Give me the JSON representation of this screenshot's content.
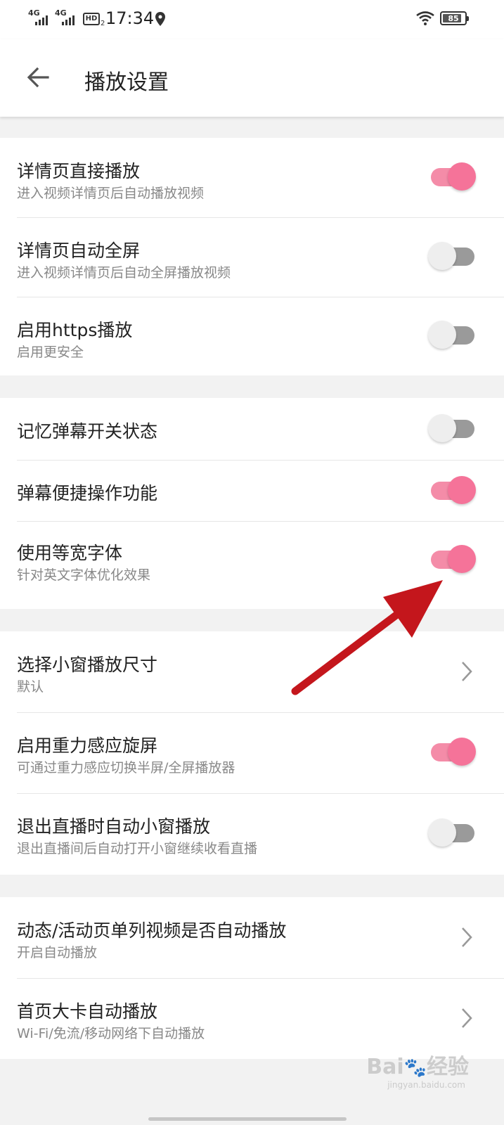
{
  "status_bar": {
    "sim1": "4G",
    "sim2": "4G",
    "hd": "HD",
    "hd_sub": "2",
    "time": "17:34",
    "battery": "85",
    "battery_level": 0.85
  },
  "header": {
    "title": "播放设置"
  },
  "groups": [
    {
      "items": [
        {
          "title": "详情页直接播放",
          "subtitle": "进入视频详情页后自动播放视频",
          "control": "toggle",
          "on": true
        },
        {
          "title": "详情页自动全屏",
          "subtitle": "进入视频详情页后自动全屏播放视频",
          "control": "toggle",
          "on": false
        },
        {
          "title": "启用https播放",
          "subtitle": "启用更安全",
          "control": "toggle",
          "on": false
        }
      ]
    },
    {
      "items": [
        {
          "title": "记忆弹幕开关状态",
          "control": "toggle",
          "on": false
        },
        {
          "title": "弹幕便捷操作功能",
          "control": "toggle",
          "on": true
        },
        {
          "title": "使用等宽字体",
          "subtitle": "针对英文字体优化效果",
          "control": "toggle",
          "on": true
        }
      ]
    },
    {
      "items": [
        {
          "title": "选择小窗播放尺寸",
          "subtitle": "默认",
          "control": "chevron"
        },
        {
          "title": "启用重力感应旋屏",
          "subtitle": "可通过重力感应切换半屏/全屏播放器",
          "control": "toggle",
          "on": true
        },
        {
          "title": "退出直播时自动小窗播放",
          "subtitle": "退出直播间后自动打开小窗继续收看直播",
          "control": "toggle",
          "on": false
        }
      ]
    },
    {
      "items": [
        {
          "title": "动态/活动页单列视频是否自动播放",
          "subtitle": "开启自动播放",
          "control": "chevron"
        },
        {
          "title": "首页大卡自动播放",
          "subtitle": "Wi-Fi/免流/移动网络下自动播放",
          "control": "chevron"
        }
      ]
    }
  ],
  "watermark": {
    "logo_left": "Bai",
    "logo_right": "经验",
    "url": "jingyan.baidu.com"
  },
  "colors": {
    "toggle_on_knob": "#f57399",
    "toggle_on_track": "#f48ca8",
    "toggle_off_knob": "#eeeeee",
    "toggle_off_track": "#9a9a9a",
    "annotation_arrow": "#c4161c"
  }
}
